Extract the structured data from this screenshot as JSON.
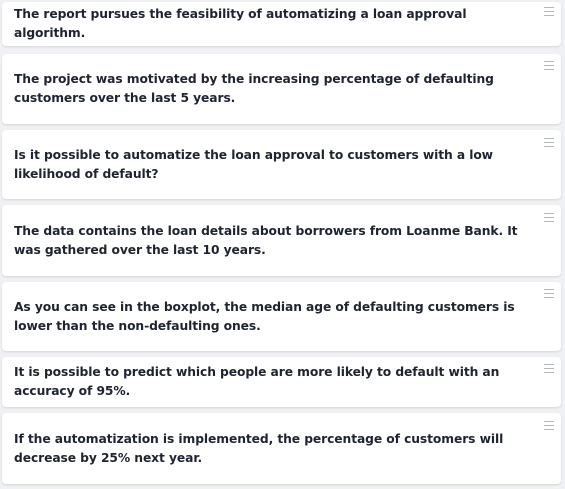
{
  "items": [
    {
      "text": "The report pursues the feasibility of automatizing a loan approval algorithm.",
      "handle_icon": "drag-handle-icon"
    },
    {
      "text": "The project was motivated by the increasing percentage of defaulting customers over the last 5 years.",
      "handle_icon": "drag-handle-icon"
    },
    {
      "text": "Is it possible to automatize the loan approval to customers with a low likelihood of default?",
      "handle_icon": "drag-handle-icon"
    },
    {
      "text": "The data contains the loan details about borrowers from Loanme Bank. It was gathered over the last 10 years.",
      "handle_icon": "drag-handle-icon"
    },
    {
      "text": "As you can see in the boxplot, the median age of defaulting customers is lower than the non-defaulting ones.",
      "handle_icon": "drag-handle-icon"
    },
    {
      "text": "It is possible to predict which people are more likely to default with an accuracy of 95%.",
      "handle_icon": "drag-handle-icon"
    },
    {
      "text": "If the automatization is implemented, the percentage of customers will decrease by 25% next year.",
      "handle_icon": "drag-handle-icon"
    }
  ],
  "colors": {
    "background": "#f0f1f4",
    "card": "#ffffff",
    "text": "#1f2430",
    "handle": "#b3b7c0"
  }
}
